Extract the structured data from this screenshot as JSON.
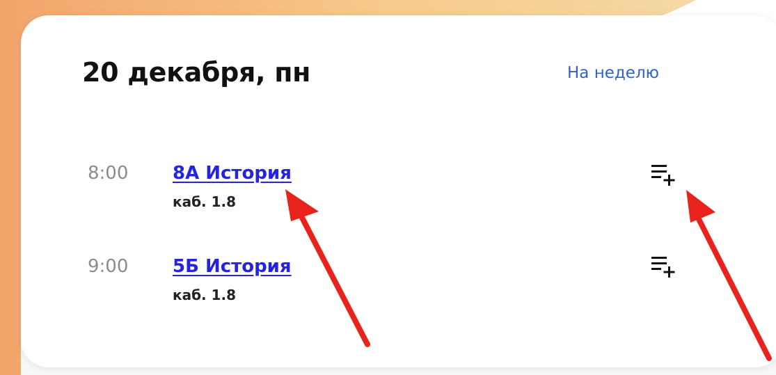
{
  "schedule": {
    "date_title": "20 декабря, пн",
    "week_link": "На неделю",
    "lessons": [
      {
        "time": "8:00",
        "name": "8А История",
        "room": "каб. 1.8"
      },
      {
        "time": "9:00",
        "name": "5Б История",
        "room": "каб. 1.8"
      }
    ]
  },
  "colors": {
    "link": "#2f63c8",
    "lesson_link": "#2424e0",
    "annotation_arrow": "#e8231c",
    "background_accent": "#f4a261"
  },
  "icons": {
    "add_homework": "add-to-list-icon"
  }
}
